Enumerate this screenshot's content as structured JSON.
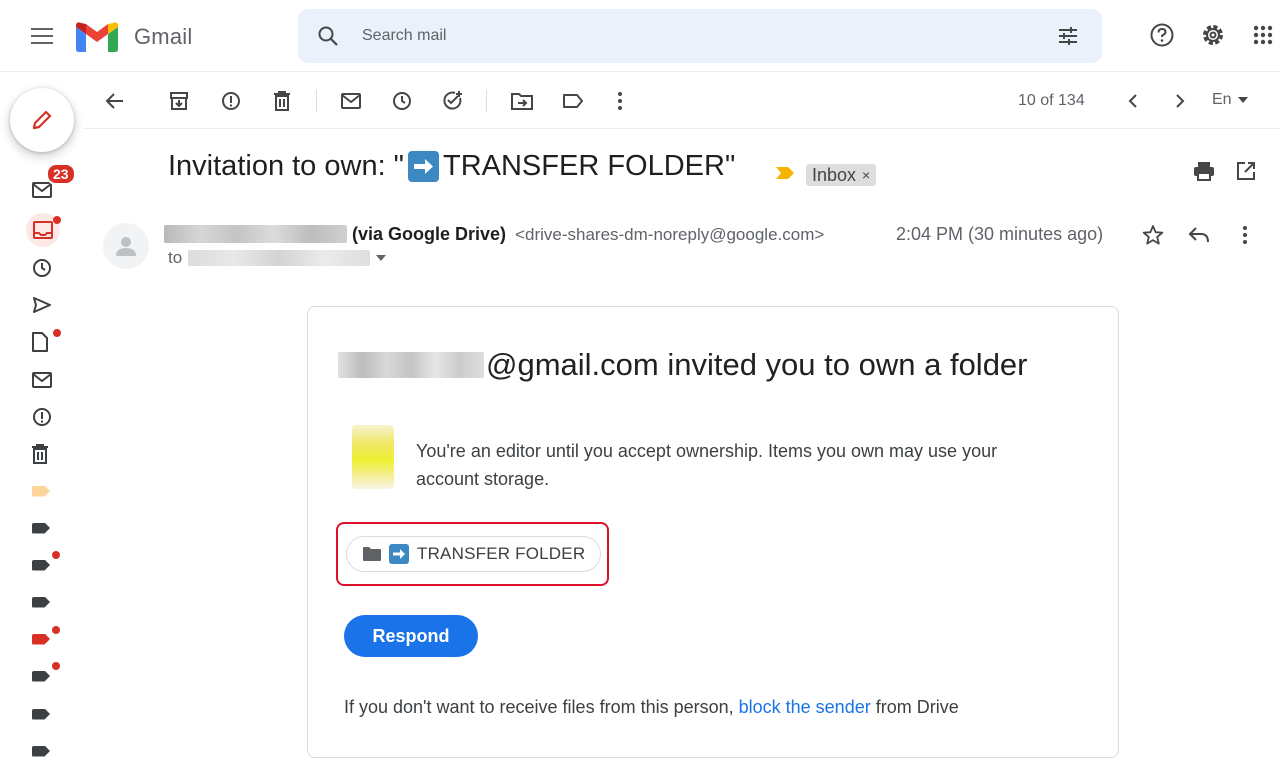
{
  "header": {
    "app_name": "Gmail",
    "search_placeholder": "Search mail",
    "icons": [
      "menu-icon",
      "gmail-logo",
      "search-icon",
      "tune-icon",
      "help-icon",
      "settings-icon",
      "apps-icon"
    ]
  },
  "rail": {
    "unread_badge": "23",
    "items": [
      {
        "name": "mail-icon"
      },
      {
        "name": "inbox-icon",
        "active": true,
        "dot": true
      },
      {
        "name": "snoozed-icon"
      },
      {
        "name": "sent-icon"
      },
      {
        "name": "drafts-icon",
        "dot": true
      },
      {
        "name": "all-mail-icon"
      },
      {
        "name": "spam-icon"
      },
      {
        "name": "trash-icon"
      },
      {
        "name": "label-icon",
        "color": "#fbd59c"
      },
      {
        "name": "label-icon",
        "color": "#3c4043"
      },
      {
        "name": "label-icon",
        "color": "#3c4043",
        "dot": true
      },
      {
        "name": "label-icon",
        "color": "#3c4043"
      },
      {
        "name": "label-icon",
        "color": "#d93025",
        "dot": true
      },
      {
        "name": "label-icon",
        "color": "#3c4043",
        "dot": true
      },
      {
        "name": "label-icon",
        "color": "#3c4043"
      },
      {
        "name": "label-icon",
        "color": "#3c4043"
      }
    ]
  },
  "toolbar": {
    "pager": "10 of 134",
    "lang": "En"
  },
  "message": {
    "subject_prefix": "Invitation to own: \"",
    "subject_folder": " TRANSFER FOLDER\"",
    "label": "Inbox",
    "label_remove": "×",
    "sender_via": "(via Google Drive)",
    "sender_email": "<drive-shares-dm-noreply@google.com>",
    "time": "2:04 PM (30 minutes ago)",
    "to_label": "to"
  },
  "card": {
    "title_suffix": "@gmail.com invited you to own a folder",
    "body": "You're an editor until you accept ownership. Items you own may use your account storage.",
    "folder_name": "TRANSFER FOLDER",
    "respond": "Respond",
    "footer_before": "If you don't want to receive files from this person, ",
    "footer_link": "block the sender",
    "footer_after": " from Drive"
  },
  "colors": {
    "brand_blue": "#1a73e8",
    "highlight": "#e0102c",
    "badge": "#d93025",
    "search_bg": "#eaf1fb"
  }
}
